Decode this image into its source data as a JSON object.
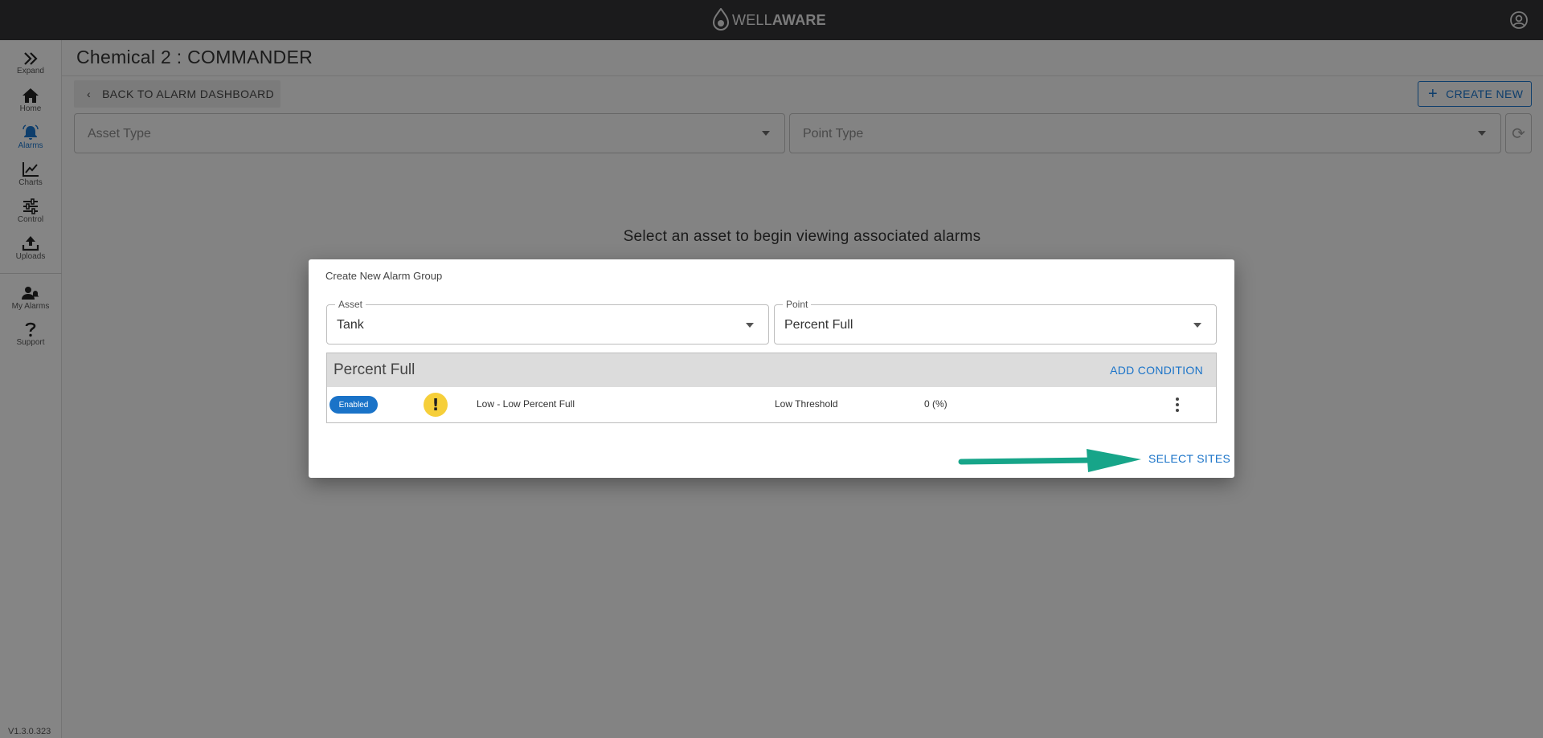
{
  "header": {
    "brand_prefix": "WELL",
    "brand_suffix": "AWARE",
    "account_icon": "account-circle-icon"
  },
  "sidebar": {
    "items": [
      {
        "label": "Expand",
        "icon": "double-chevron-right-icon"
      },
      {
        "label": "Home",
        "icon": "home-icon"
      },
      {
        "label": "Alarms",
        "icon": "bell-icon",
        "active": true
      },
      {
        "label": "Charts",
        "icon": "line-chart-icon"
      },
      {
        "label": "Control",
        "icon": "sliders-icon"
      },
      {
        "label": "Uploads",
        "icon": "upload-icon"
      },
      {
        "label": "My Alarms",
        "icon": "people-alarm-icon"
      },
      {
        "label": "Support",
        "icon": "question-icon"
      }
    ],
    "version": "V1.3.0.323"
  },
  "main": {
    "title": "Chemical 2 : COMMANDER",
    "back_label": "BACK TO ALARM DASHBOARD",
    "create_label": "CREATE NEW",
    "asset_type_placeholder": "Asset Type",
    "point_type_placeholder": "Point Type",
    "empty_message": "Select an asset to begin viewing associated alarms"
  },
  "modal": {
    "title": "Create New Alarm Group",
    "asset": {
      "label": "Asset",
      "value": "Tank"
    },
    "point": {
      "label": "Point",
      "value": "Percent Full"
    },
    "conditions_header": "Percent Full",
    "add_condition_label": "ADD CONDITION",
    "conditions": [
      {
        "status": "Enabled",
        "severity_glyph": "!",
        "name": "Low - Low Percent Full",
        "type": "Low Threshold",
        "value": "0 (%)"
      }
    ],
    "select_sites_label": "SELECT SITES"
  },
  "colors": {
    "accent": "#1a73c8",
    "topbar": "#333335",
    "warning": "#f6cf3a",
    "arrow": "#17a589"
  }
}
